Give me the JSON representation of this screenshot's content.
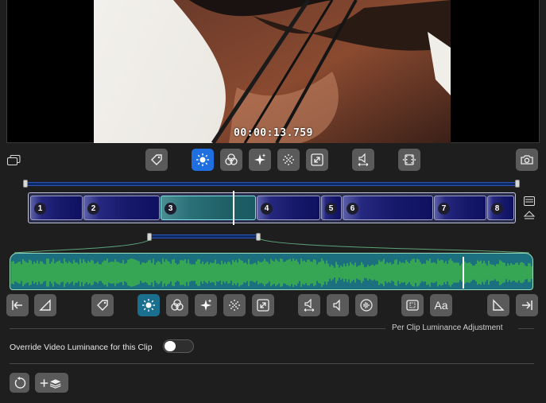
{
  "video": {
    "timecode": "00:00:13.759"
  },
  "clips": [
    {
      "num": "1"
    },
    {
      "num": "2"
    },
    {
      "num": "3"
    },
    {
      "num": "4"
    },
    {
      "num": "5"
    },
    {
      "num": "6"
    },
    {
      "num": "7"
    },
    {
      "num": "8"
    }
  ],
  "top_toolbar": [
    "tag-icon",
    "brightness-icon",
    "color-circles-icon",
    "sparkles-icon",
    "grain-icon",
    "expand-icon",
    "audio-trim-icon",
    "film-trim-icon",
    "camera-icon"
  ],
  "bottom_toolbar": [
    "go-start-icon",
    "fade-in-icon",
    "tag-icon",
    "brightness-icon",
    "color-circles-icon",
    "sparkles-icon",
    "grain-icon",
    "expand-icon",
    "audio-trim-icon",
    "speaker-icon",
    "audio-wave-icon",
    "crop-icon",
    "text-icon",
    "fade-out-icon",
    "go-end-icon"
  ],
  "text_button_label": "Aa",
  "section": {
    "title": "Per Clip Luminance Adjustment"
  },
  "override": {
    "label": "Override Video Luminance for this Clip",
    "enabled": false
  },
  "colors": {
    "accent": "#1f6fe0",
    "selected_clip": "#2b7078",
    "waveform": "#3cb54a"
  }
}
